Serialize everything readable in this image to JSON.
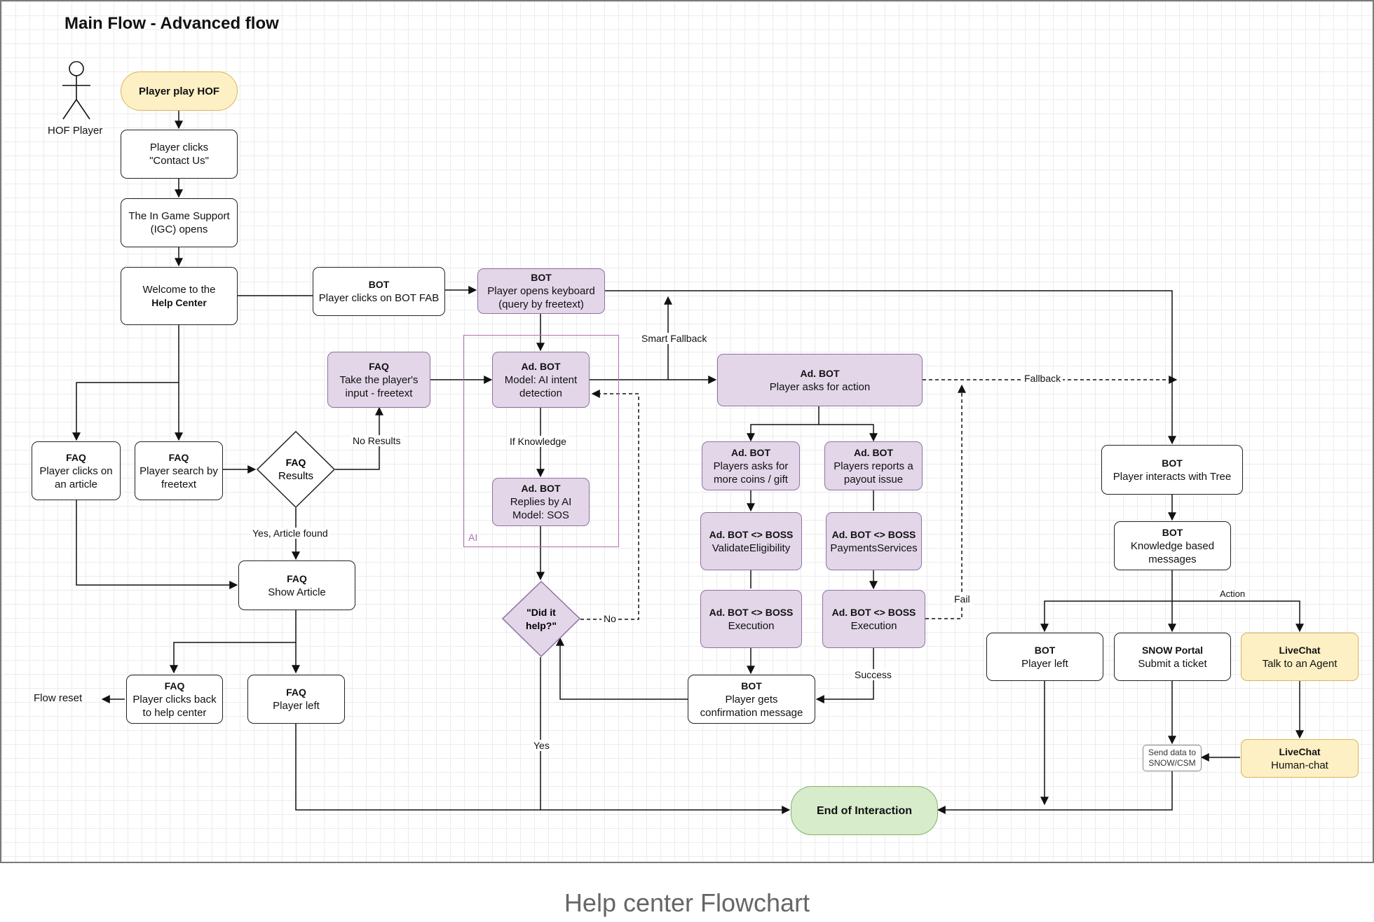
{
  "title": "Main Flow - Advanced flow",
  "caption": "Help center Flowchart",
  "actor": {
    "label": "HOF Player",
    "icon": "stick-figure-icon"
  },
  "ai_group_label": "AI",
  "colors": {
    "purple": "#e2d6e8",
    "yellow": "#fdf0c4",
    "green": "#d7eccb",
    "ai_border": "#b46fb4"
  },
  "nodes": {
    "player_play": {
      "header": "",
      "text": "Player play HOF"
    },
    "contact_us": {
      "header": "",
      "text": "Player clicks\n\"Contact Us\""
    },
    "igc_opens": {
      "header": "",
      "text": "The In Game Support\n(IGC) opens"
    },
    "welcome": {
      "header": "",
      "text": "Welcome to the",
      "text2": "Help Center"
    },
    "bot_fab": {
      "header": "BOT",
      "text": "Player clicks on BOT FAB"
    },
    "bot_keyboard": {
      "header": "BOT",
      "text": "Player opens keyboard\n(query by freetext)"
    },
    "faq_freetext_input": {
      "header": "FAQ",
      "text": "Take the player's\ninput - freetext"
    },
    "ad_intent": {
      "header": "Ad. BOT",
      "text": "Model: AI intent\ndetection"
    },
    "ad_action": {
      "header": "Ad. BOT",
      "text": "Player asks for action"
    },
    "faq_article": {
      "header": "FAQ",
      "text": "Player clicks on\nan article"
    },
    "faq_search": {
      "header": "FAQ",
      "text": "Player search by\nfreetext"
    },
    "faq_results": {
      "header": "FAQ",
      "text": "Results"
    },
    "ad_replies": {
      "header": "Ad. BOT",
      "text": "Replies by AI\nModel: SOS"
    },
    "coins": {
      "header": "Ad. BOT",
      "text": "Players asks for\nmore coins / gift"
    },
    "payout": {
      "header": "Ad. BOT",
      "text": "Players reports a\npayout issue"
    },
    "validate": {
      "header": "Ad. BOT <> BOSS",
      "text": "ValidateEligibility"
    },
    "payments": {
      "header": "Ad. BOT <> BOSS",
      "text": "PaymentsServices"
    },
    "exec1": {
      "header": "Ad. BOT <> BOSS",
      "text": "Execution"
    },
    "exec2": {
      "header": "Ad. BOT <> BOSS",
      "text": "Execution"
    },
    "bot_tree": {
      "header": "BOT",
      "text": "Player interacts with Tree"
    },
    "bot_knowledge": {
      "header": "BOT",
      "text": "Knowledge based\nmessages"
    },
    "faq_show": {
      "header": "FAQ",
      "text": "Show Article"
    },
    "did_it_help": {
      "header": "\"Did it\nhelp?\"",
      "text": ""
    },
    "faq_back": {
      "header": "FAQ",
      "text": "Player clicks back\nto help center"
    },
    "faq_left": {
      "header": "FAQ",
      "text": "Player left"
    },
    "bot_confirm": {
      "header": "BOT",
      "text": "Player gets\nconfirmation message"
    },
    "bot_left": {
      "header": "BOT",
      "text": "Player left"
    },
    "snow": {
      "header": "SNOW Portal",
      "text": "Submit a ticket"
    },
    "livechat_agent": {
      "header": "LiveChat",
      "text": "Talk to an Agent"
    },
    "livechat_human": {
      "header": "LiveChat",
      "text": "Human-chat"
    },
    "send_data": {
      "header": "",
      "text": "Send data to\nSNOW/CSM"
    },
    "end": {
      "header": "",
      "text": "End of Interaction"
    }
  },
  "edge_labels": {
    "smart_fallback": "Smart Fallback",
    "fallback": "Fallback",
    "no_results": "No Results",
    "if_knowledge": "If Knowledge",
    "yes_article": "Yes, Article found",
    "no": "No",
    "yes": "Yes",
    "fail": "Fail",
    "success": "Success",
    "action": "Action",
    "flow_reset": "Flow reset"
  }
}
